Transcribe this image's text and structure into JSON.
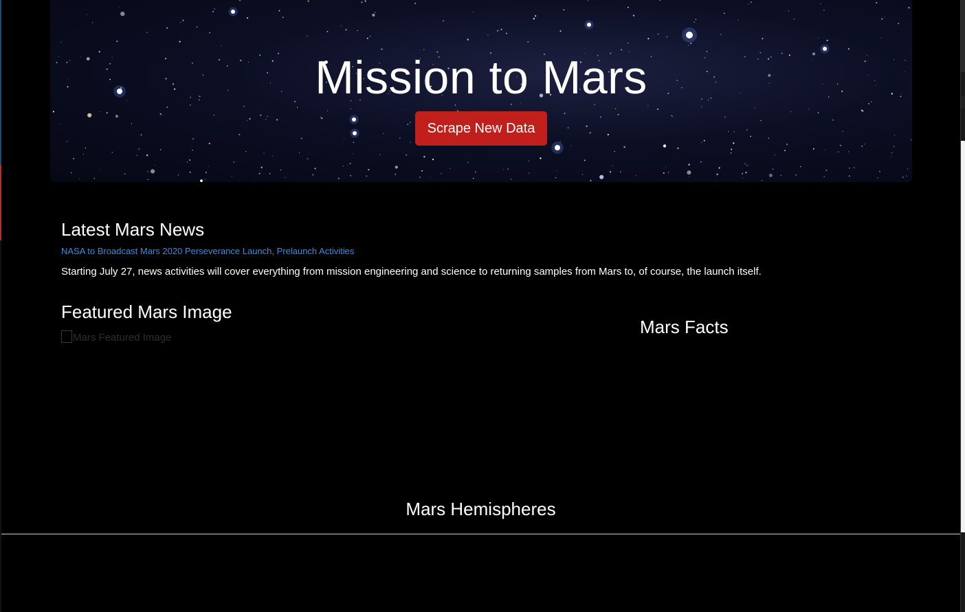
{
  "header": {
    "title": "Mission to Mars",
    "scrape_button_label": "Scrape New Data"
  },
  "news": {
    "heading": "Latest Mars News",
    "title": "NASA to Broadcast Mars 2020 Perseverance Launch, Prelaunch Activities",
    "paragraph": "Starting July 27, news activities will cover everything from mission engineering and science to returning samples from Mars to, of course, the launch itself."
  },
  "featured_image": {
    "heading": "Featured Mars Image",
    "alt_text": "Mars Featured Image"
  },
  "facts": {
    "heading": "Mars Facts"
  },
  "hemispheres": {
    "heading": "Mars Hemispheres"
  },
  "colors": {
    "background": "#000000",
    "button": "#c11f1c",
    "link": "#3a8be0",
    "text": "#ffffff"
  }
}
